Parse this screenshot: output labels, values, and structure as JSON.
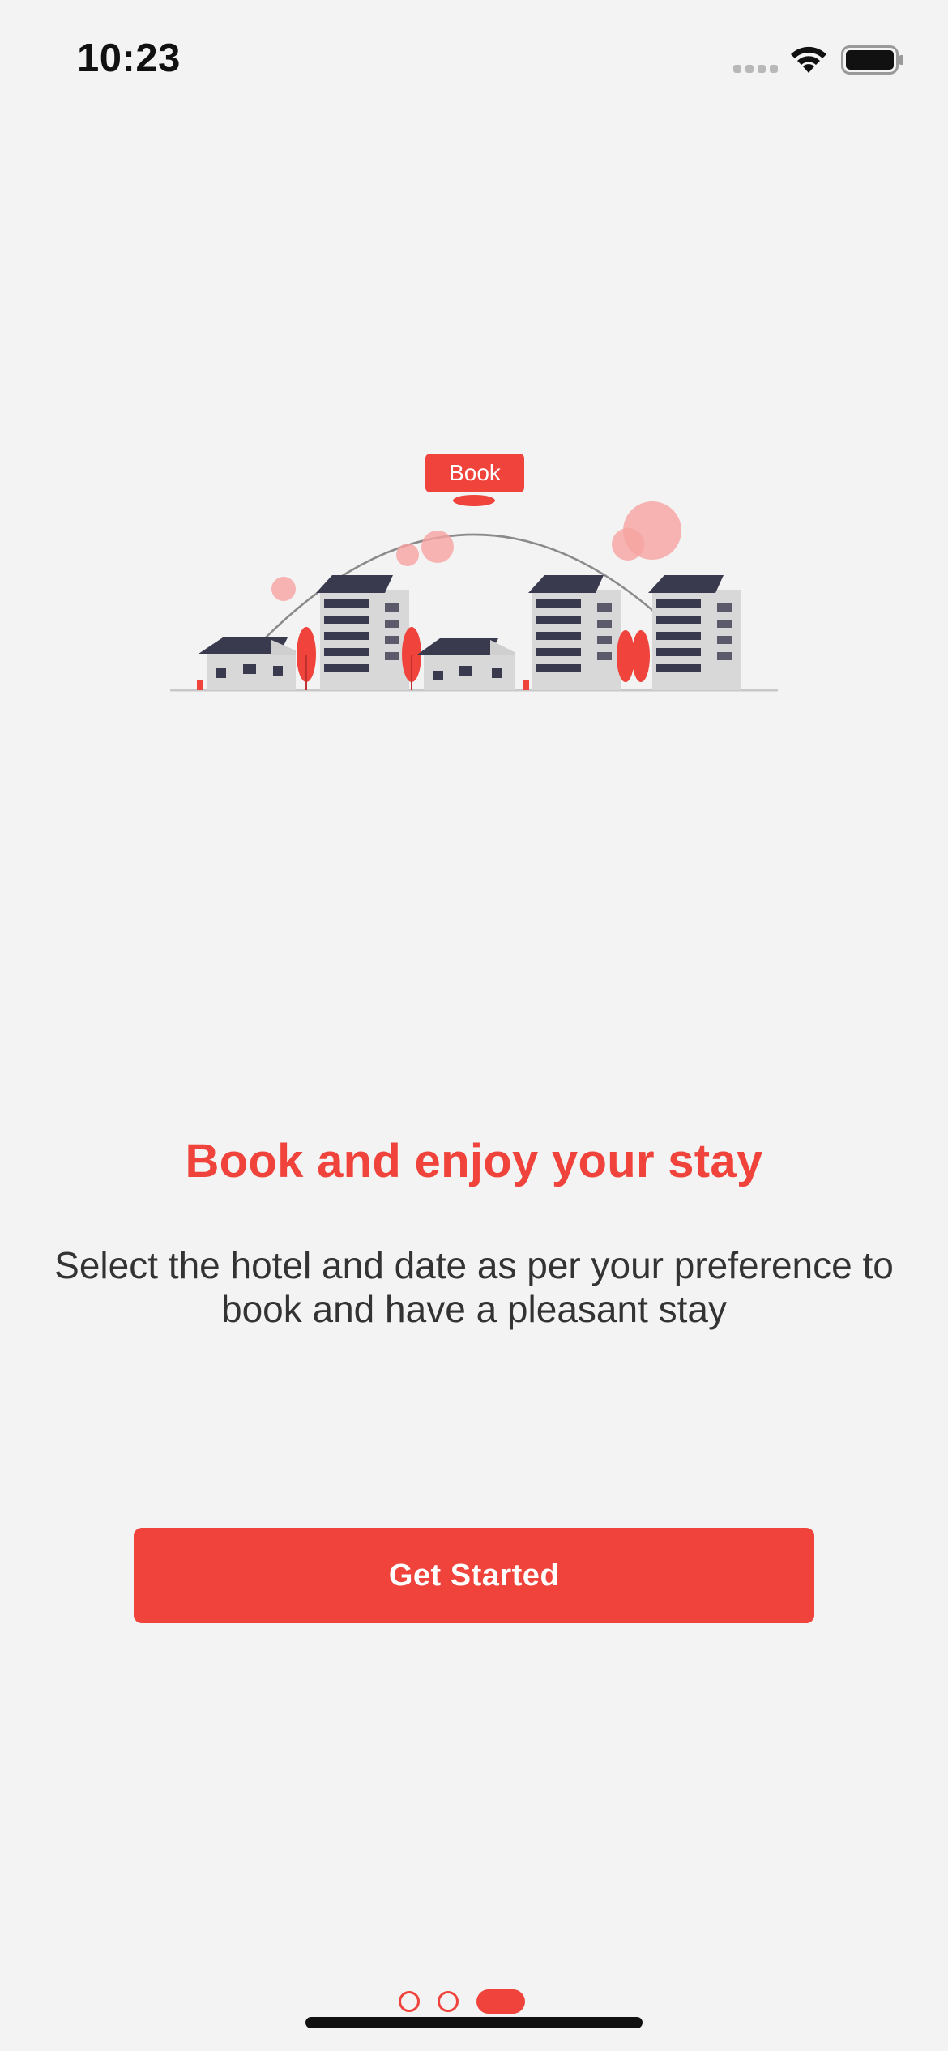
{
  "status_bar": {
    "time": "10:23"
  },
  "illustration": {
    "badge_label": "Book",
    "icon": "hotel-booking-illustration"
  },
  "onboarding": {
    "title": "Book and enjoy your stay",
    "description": "Select the hotel and date as per your preference to book and have a pleasant stay",
    "button_label": "Get Started",
    "page_index": 3,
    "page_count": 3
  },
  "colors": {
    "accent": "#ef433b",
    "background": "#f3f3f3",
    "text": "#333333",
    "building_roof": "#3a3a4f",
    "building_wall": "#d8d8d8",
    "bubble": "#f6a3a0"
  }
}
